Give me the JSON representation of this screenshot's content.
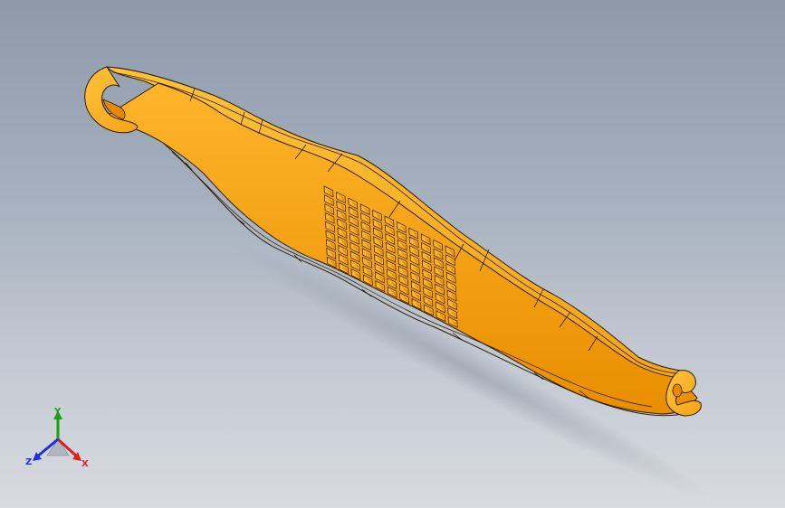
{
  "viewport": {
    "background_top": "#8d9aaa",
    "background_bottom": "#d8dbe0"
  },
  "model": {
    "part_color": "#f29a00",
    "edge_color": "#2a1a00",
    "grid_rows": 9,
    "grid_cols": 11
  },
  "triad": {
    "x_label": "X",
    "y_label": "Y",
    "z_label": "Z",
    "x_color": "#e02020",
    "y_color": "#18a018",
    "z_color": "#2030e0"
  }
}
